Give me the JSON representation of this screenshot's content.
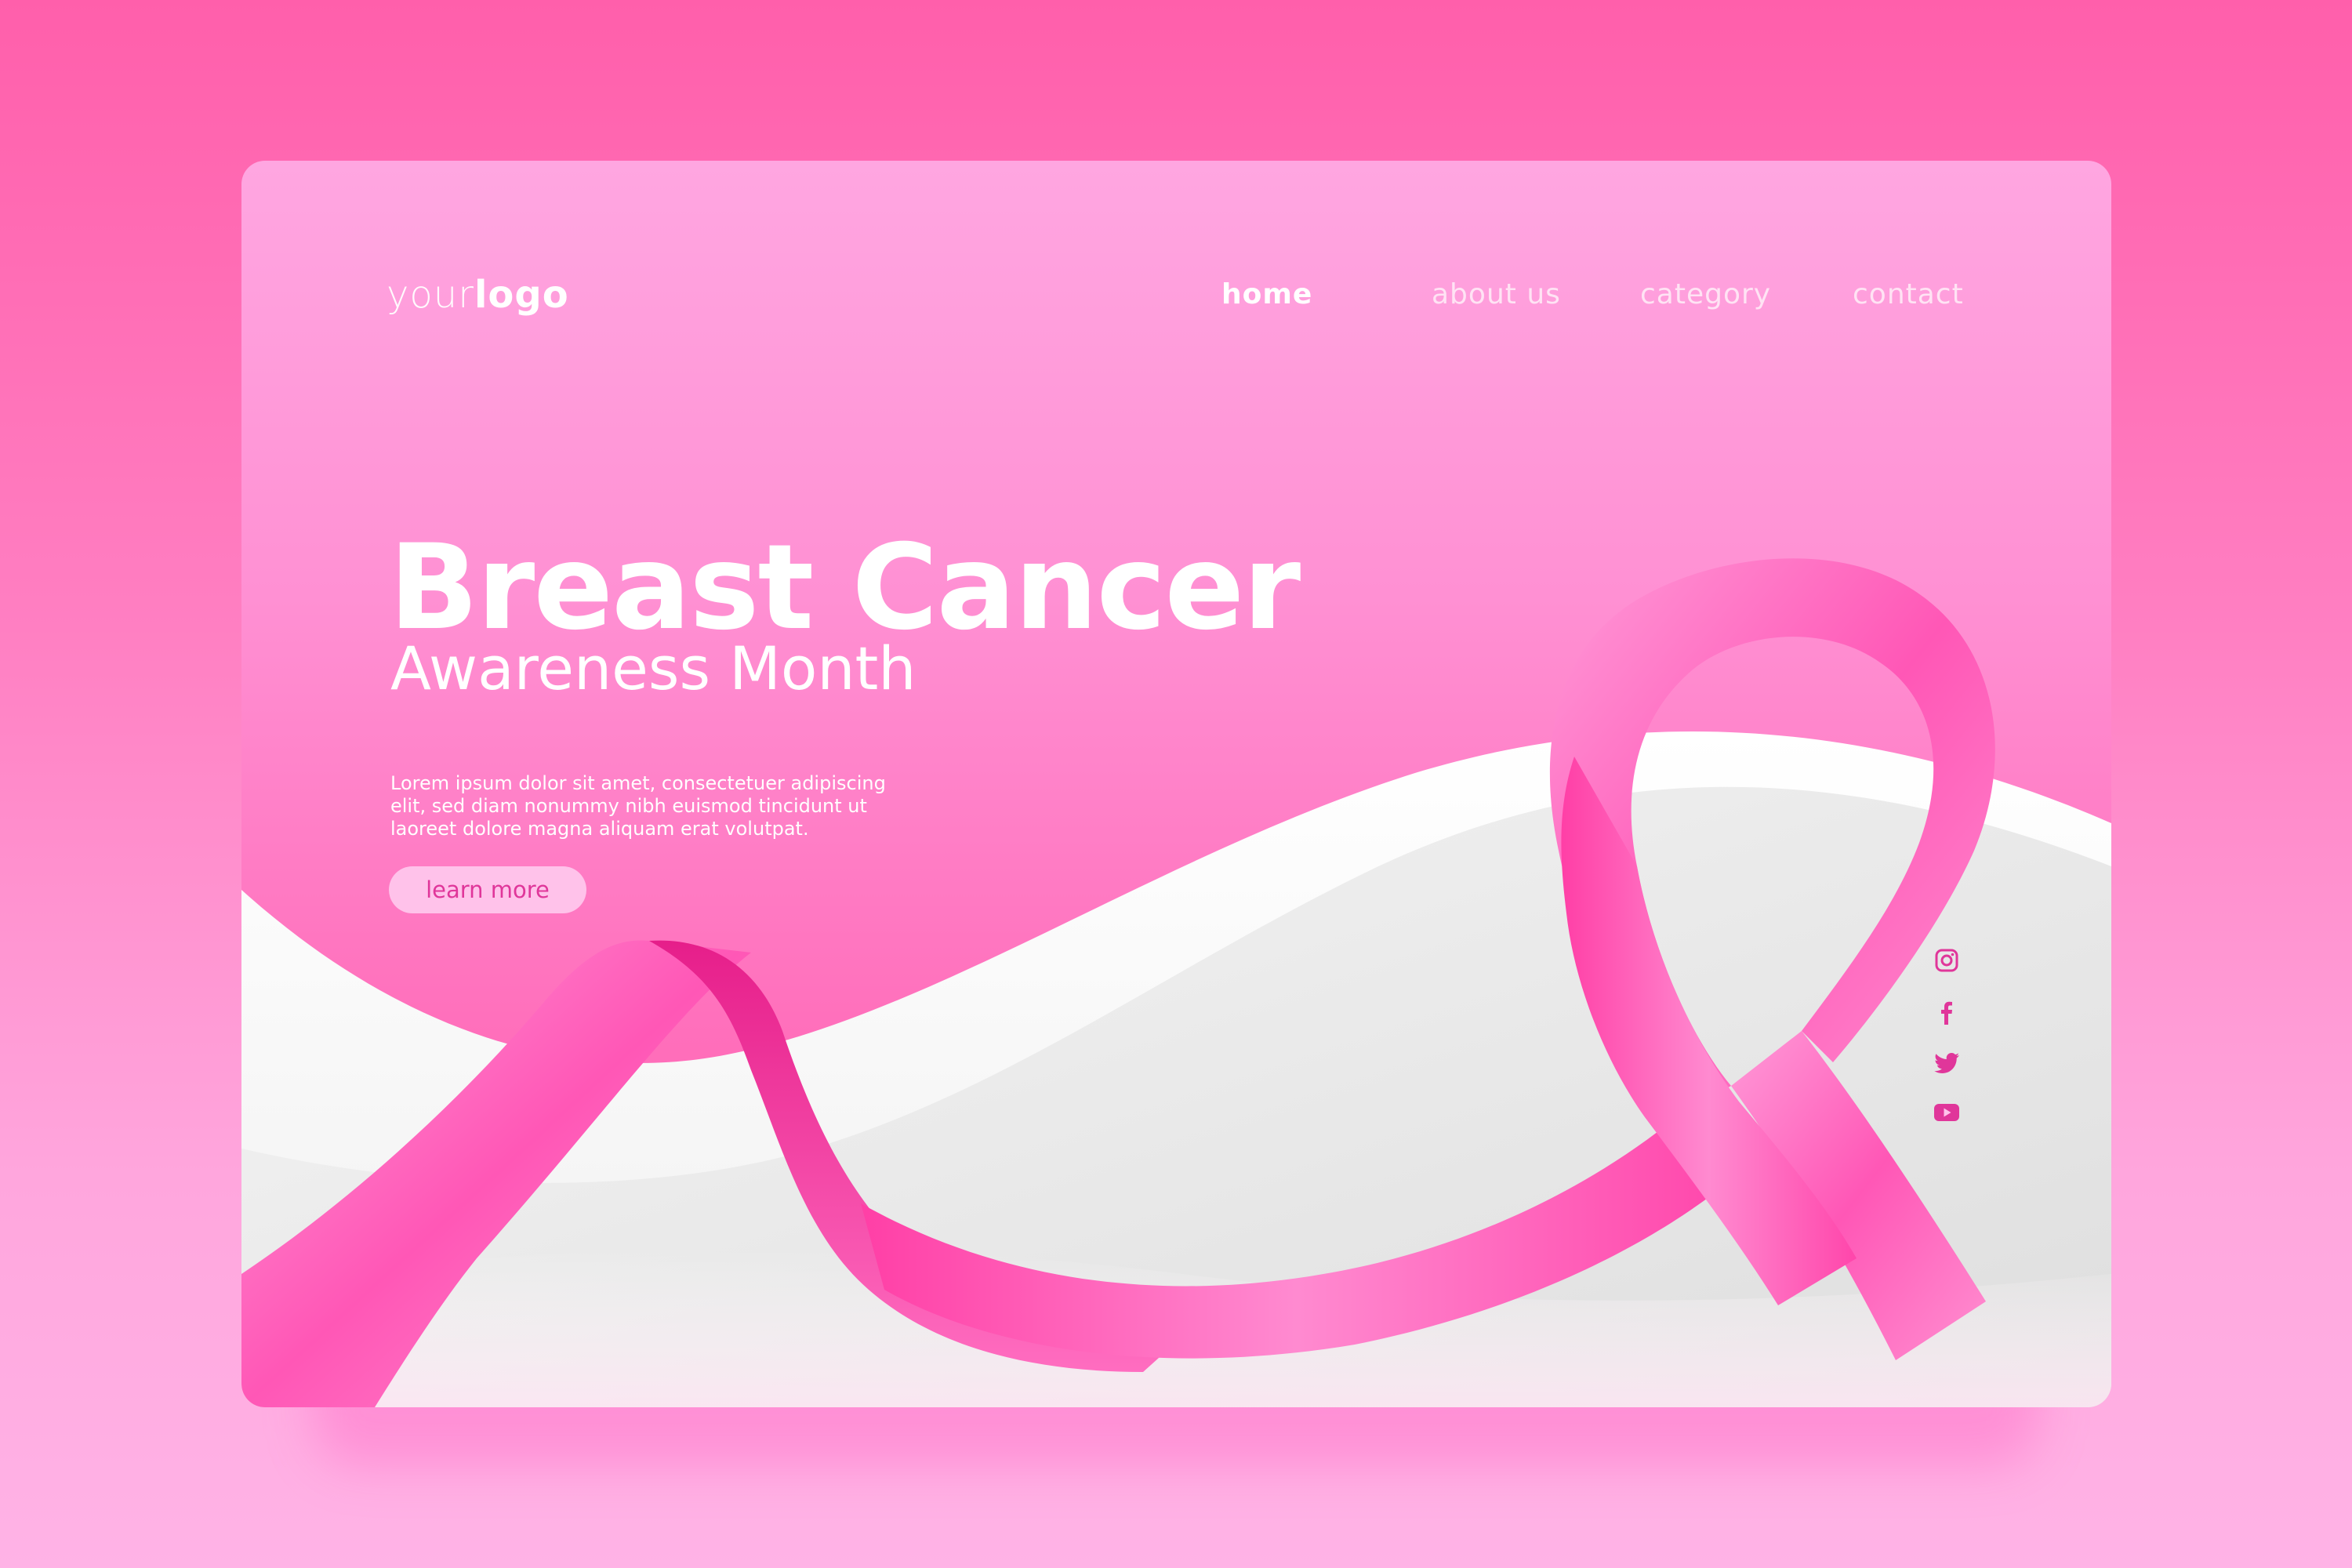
{
  "logo": {
    "light": "your",
    "bold": "logo"
  },
  "nav": {
    "items": [
      {
        "label": "home",
        "active": true
      },
      {
        "label": "about us",
        "active": false
      },
      {
        "label": "category",
        "active": false
      },
      {
        "label": "contact",
        "active": false
      }
    ]
  },
  "hero": {
    "title": "Breast Cancer",
    "subtitle": "Awareness Month",
    "body": "Lorem ipsum dolor sit amet, consectetuer adipiscing elit, sed diam nonummy nibh euismod tincidunt ut laoreet dolore magna aliquam erat volutpat.",
    "button_label": "learn more"
  },
  "social": {
    "icons": [
      "instagram-icon",
      "facebook-icon",
      "twitter-icon",
      "youtube-icon"
    ]
  },
  "colors": {
    "page_background": "#ff5fab",
    "card_top": "#ffa6e1",
    "card_bottom": "#ff5aae",
    "ribbon": "#ff4fb2",
    "accent_text": "#e0369a",
    "button_background": "#ffc2ea"
  }
}
